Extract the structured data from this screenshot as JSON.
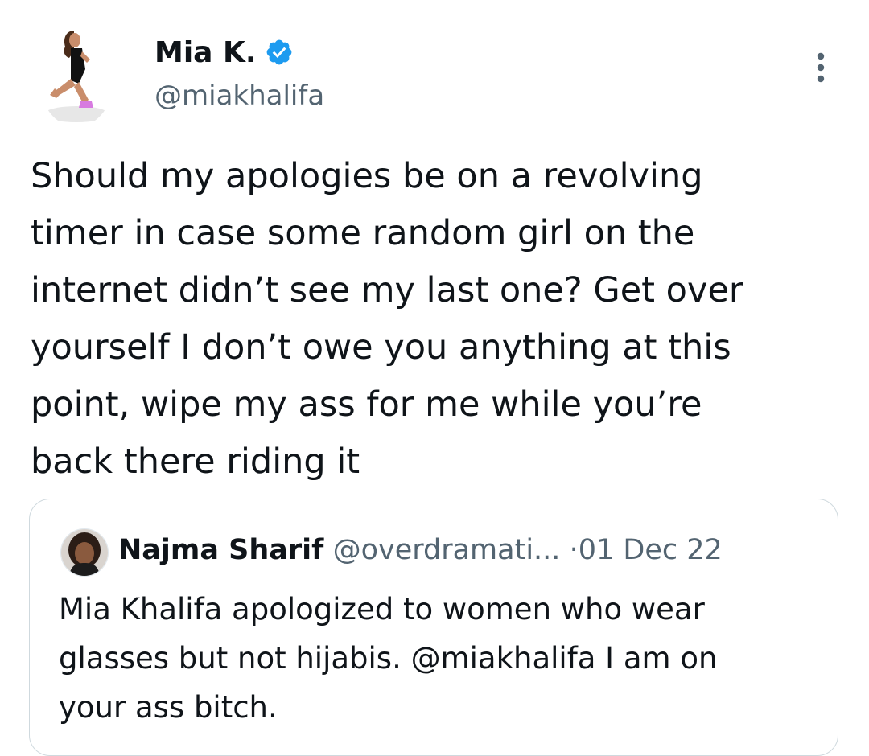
{
  "tweet": {
    "author": {
      "name": "Mia K.",
      "handle": "@miakhalifa",
      "verified": true
    },
    "text": "Should my apologies be on a revolving\ntimer in case some random girl on the\ninternet didn’t see my last one? Get over\nyourself I don’t owe you anything at this\npoint, wipe my ass for me while you’re\nback there riding it",
    "icons": {
      "verified": "verified-badge-icon",
      "more": "more-options-icon"
    }
  },
  "quote": {
    "author": {
      "name": "Najma Sharif",
      "handle": "@overdramati...",
      "separator": "·",
      "date": "01 Dec 22"
    },
    "text": "Mia Khalifa apologized to women who wear\nglasses but not hijabis. @miakhalifa I am on\nyour ass bitch."
  },
  "colors": {
    "verified_blue": "#1d9bf0",
    "text_primary": "#0f1419",
    "text_secondary": "#536471",
    "border": "#cfd9de"
  }
}
